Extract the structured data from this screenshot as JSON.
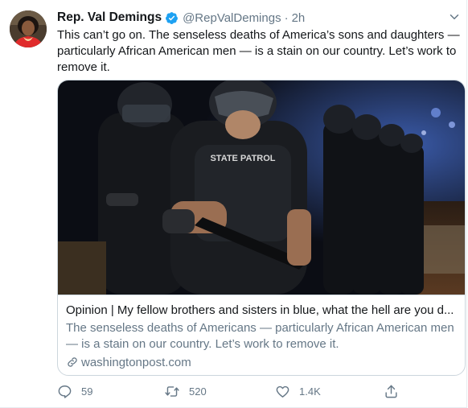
{
  "author": {
    "name": "Rep. Val Demings",
    "handle": "@RepValDemings",
    "separator": "·",
    "time": "2h"
  },
  "tweet": {
    "text": "This can’t go on. The senseless deaths of America’s sons and daughters — particularly African American men — is a stain on our country. Let’s work to remove it."
  },
  "card": {
    "image_text": "STATE PATROL",
    "title": "Opinion | My fellow brothers and sisters in blue, what the hell are you d...",
    "description": "The senseless deaths of Americans — particularly African American men — is a stain on our country. Let’s work to remove it.",
    "domain": "washingtonpost.com"
  },
  "actions": {
    "replies": "59",
    "retweets": "520",
    "likes": "1.4K"
  },
  "icons": {
    "verified": "verified-badge-icon",
    "more": "chevron-down-icon",
    "link": "link-icon",
    "reply": "reply-icon",
    "retweet": "retweet-icon",
    "like": "heart-icon",
    "share": "share-icon"
  },
  "colors": {
    "accent": "#1da1f2",
    "text": "#14171a",
    "muted": "#657786",
    "border": "#ccd6dd"
  }
}
